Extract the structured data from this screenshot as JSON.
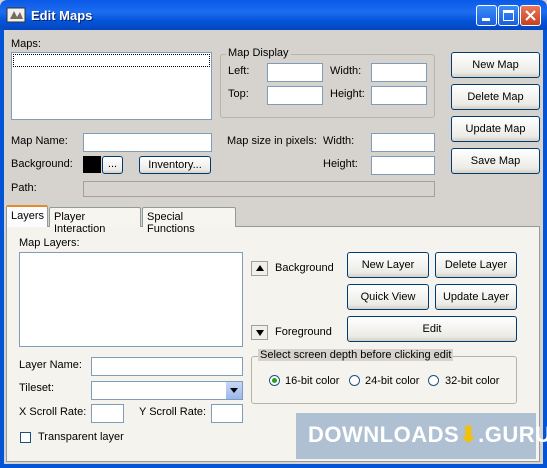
{
  "window": {
    "title": "Edit Maps"
  },
  "maps": {
    "label": "Maps:"
  },
  "map_display": {
    "group_title": "Map Display",
    "left_label": "Left:",
    "width_label": "Width:",
    "top_label": "Top:",
    "height_label": "Height:"
  },
  "buttons": {
    "new_map": "New Map",
    "delete_map": "Delete Map",
    "update_map": "Update Map",
    "save_map": "Save Map",
    "ellipsis": "...",
    "inventory": "Inventory...",
    "new_layer": "New Layer",
    "delete_layer": "Delete Layer",
    "quick_view": "Quick View",
    "update_layer": "Update Layer",
    "edit": "Edit"
  },
  "form": {
    "map_name_label": "Map Name:",
    "background_label": "Background:",
    "path_label": "Path:",
    "size_label": "Map size in pixels:",
    "size_width_label": "Width:",
    "size_height_label": "Height:",
    "background_color": "#000000"
  },
  "tabs": [
    {
      "label": "Layers"
    },
    {
      "label": "Player Interaction"
    },
    {
      "label": "Special Functions"
    }
  ],
  "layers": {
    "map_layers_label": "Map Layers:",
    "background_label": "Background",
    "foreground_label": "Foreground",
    "layer_name_label": "Layer Name:",
    "tileset_label": "Tileset:",
    "x_scroll_label": "X Scroll Rate:",
    "y_scroll_label": "Y Scroll Rate:",
    "transparent_label": "Transparent layer"
  },
  "depth": {
    "group_title": "Select screen depth before clicking edit",
    "options": [
      "16-bit color",
      "24-bit color",
      "32-bit color"
    ],
    "selected": "16-bit color"
  },
  "watermark": {
    "text": "DOWNLOADS",
    "suffix": ".GURU"
  }
}
